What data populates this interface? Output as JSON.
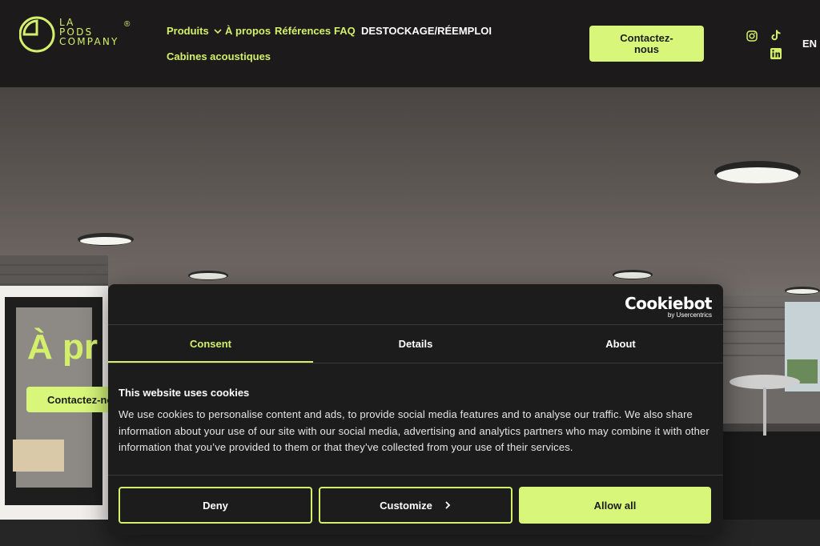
{
  "brand": {
    "logo_lines": [
      "LA",
      "PODS",
      "COMPANY"
    ],
    "registered": "®",
    "accent_color": "#d4f06a"
  },
  "nav": {
    "produits": "Produits",
    "apropos": "À propos",
    "references": "Références",
    "faq": "FAQ",
    "destockage": "DESTOCKAGE/RÉEMPLOI",
    "cabines": "Cabines acoustiques",
    "contact_line1": "Contactez-",
    "contact_line2": "nous",
    "language": "EN"
  },
  "social_icons": [
    "instagram-icon",
    "tiktok-icon",
    "linkedin-icon"
  ],
  "hero": {
    "title": "À pr",
    "button": "Contactez-no"
  },
  "cookie_dialog": {
    "provider_logo": "Cookiebot",
    "provider_sub": "by Usercentrics",
    "tabs": [
      "Consent",
      "Details",
      "About"
    ],
    "active_tab": "Consent",
    "title": "This website uses cookies",
    "body": "We use cookies to personalise content and ads, to provide social media features and to analyse our traffic. We also share information about your use of our site with our social media, advertising and analytics partners who may combine it with other information that you’ve provided to them or that they’ve collected from your use of their services.",
    "buttons": {
      "deny": "Deny",
      "customize": "Customize",
      "allow_all": "Allow all"
    }
  }
}
